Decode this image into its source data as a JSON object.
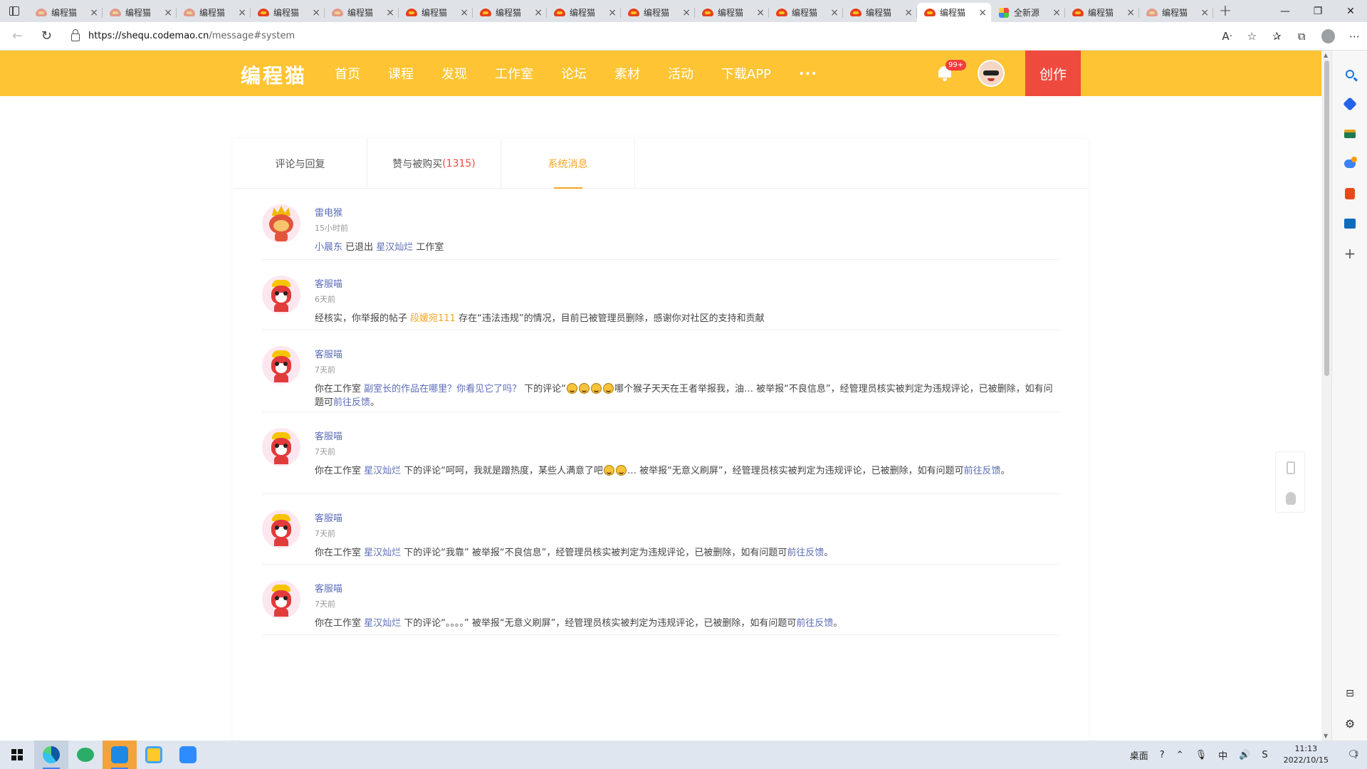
{
  "browser": {
    "tabs": [
      {
        "title": "编程猫",
        "icon": "codemao-faded-icon",
        "active": false
      },
      {
        "title": "编程猫",
        "icon": "codemao-faded-icon",
        "active": false
      },
      {
        "title": "编程猫",
        "icon": "codemao-faded-icon",
        "active": false
      },
      {
        "title": "编程猫",
        "icon": "codemao-icon",
        "active": false
      },
      {
        "title": "编程猫",
        "icon": "codemao-faded-icon",
        "active": false
      },
      {
        "title": "编程猫",
        "icon": "codemao-icon",
        "active": false
      },
      {
        "title": "编程猫",
        "icon": "codemao-icon",
        "active": false
      },
      {
        "title": "编程猫",
        "icon": "codemao-icon",
        "active": false
      },
      {
        "title": "编程猫",
        "icon": "codemao-icon",
        "active": false
      },
      {
        "title": "编程猫",
        "icon": "codemao-icon",
        "active": false
      },
      {
        "title": "编程猫",
        "icon": "codemao-icon",
        "active": false
      },
      {
        "title": "编程猫",
        "icon": "codemao-icon",
        "active": false
      },
      {
        "title": "编程猫",
        "icon": "codemao-icon",
        "active": true
      },
      {
        "title": "全新源",
        "icon": "colorful-app-icon",
        "active": false
      },
      {
        "title": "编程猫",
        "icon": "codemao-icon",
        "active": false
      },
      {
        "title": "编程猫",
        "icon": "codemao-faded-icon",
        "active": false
      }
    ],
    "url_host": "https://shequ.codemao.cn",
    "url_path": "/message#system",
    "new_tab": "+",
    "min": "—",
    "restore": "❐",
    "close": "✕"
  },
  "site": {
    "logo": "编程猫",
    "nav": [
      "首页",
      "课程",
      "发现",
      "工作室",
      "论坛",
      "素材",
      "活动",
      "下载APP"
    ],
    "nav_more": "···",
    "notify_badge": "99+",
    "create": "创作"
  },
  "message_tabs": {
    "comments": "评论与回复",
    "likes": "赞与被购买",
    "likes_count": "(1315)",
    "system": "系统消息"
  },
  "messages": [
    {
      "sender": "雷电猴",
      "time": "15小时前",
      "parts": [
        {
          "t": "小晨东",
          "c": "lnk"
        },
        {
          "t": " 已退出 ",
          "c": ""
        },
        {
          "t": "星汉灿烂",
          "c": "lnk"
        },
        {
          "t": " 工作室",
          "c": ""
        }
      ]
    },
    {
      "sender": "客服喵",
      "time": "6天前",
      "parts": [
        {
          "t": "经核实，你举报的帖子 ",
          "c": ""
        },
        {
          "t": "段媛宛111",
          "c": "lnk-orange"
        },
        {
          "t": " 存在“违法违规”的情况，目前已被管理员删除，感谢你对社区的支持和贡献",
          "c": ""
        }
      ]
    },
    {
      "sender": "客服喵",
      "time": "7天前",
      "parts": [
        {
          "t": "你在工作室 ",
          "c": ""
        },
        {
          "t": "副室长的作品在哪里？你看见它了吗？",
          "c": "lnk"
        },
        {
          "t": " 下的评论“",
          "c": ""
        },
        {
          "t": "",
          "c": "emo"
        },
        {
          "t": "",
          "c": "emo"
        },
        {
          "t": "",
          "c": "emo"
        },
        {
          "t": "",
          "c": "emo"
        },
        {
          "t": "哪个猴子天天在王者举报我，油… 被举报“不良信息”，经管理员核实被判定为违规评论，已被删除，如有问题可",
          "c": ""
        },
        {
          "t": "前往反馈",
          "c": "lnk"
        },
        {
          "t": "。",
          "c": ""
        }
      ]
    },
    {
      "sender": "客服喵",
      "time": "7天前",
      "parts": [
        {
          "t": "你在工作室 ",
          "c": ""
        },
        {
          "t": "星汉灿烂",
          "c": "lnk"
        },
        {
          "t": " 下的评论“呵呵，我就是蹭热度，某些人满意了吧",
          "c": ""
        },
        {
          "t": "",
          "c": "emo"
        },
        {
          "t": "",
          "c": "emo"
        },
        {
          "t": "… 被举报“无意义刷屏”，经管理员核实被判定为违规评论，已被删除，如有问题可",
          "c": ""
        },
        {
          "t": "前往反馈",
          "c": "lnk"
        },
        {
          "t": "。",
          "c": ""
        }
      ]
    },
    {
      "sender": "客服喵",
      "time": "7天前",
      "parts": [
        {
          "t": "你在工作室 ",
          "c": ""
        },
        {
          "t": "星汉灿烂",
          "c": "lnk"
        },
        {
          "t": " 下的评论“我靠” 被举报“不良信息”，经管理员核实被判定为违规评论，已被删除，如有问题可",
          "c": ""
        },
        {
          "t": "前往反馈",
          "c": "lnk"
        },
        {
          "t": "。",
          "c": ""
        }
      ]
    },
    {
      "sender": "客服喵",
      "time": "7天前",
      "parts": [
        {
          "t": "你在工作室 ",
          "c": ""
        },
        {
          "t": "星汉灿烂",
          "c": "lnk"
        },
        {
          "t": " 下的评论“。。。。” 被举报“无意义刷屏”，经管理员核实被判定为违规评论，已被删除，如有问题可",
          "c": ""
        },
        {
          "t": "前往反馈",
          "c": "lnk"
        },
        {
          "t": "。",
          "c": ""
        }
      ]
    }
  ],
  "taskbar": {
    "desktop": "桌面",
    "ime": "中",
    "time": "11:13",
    "date": "2022/10/15",
    "notify_count": "1"
  }
}
